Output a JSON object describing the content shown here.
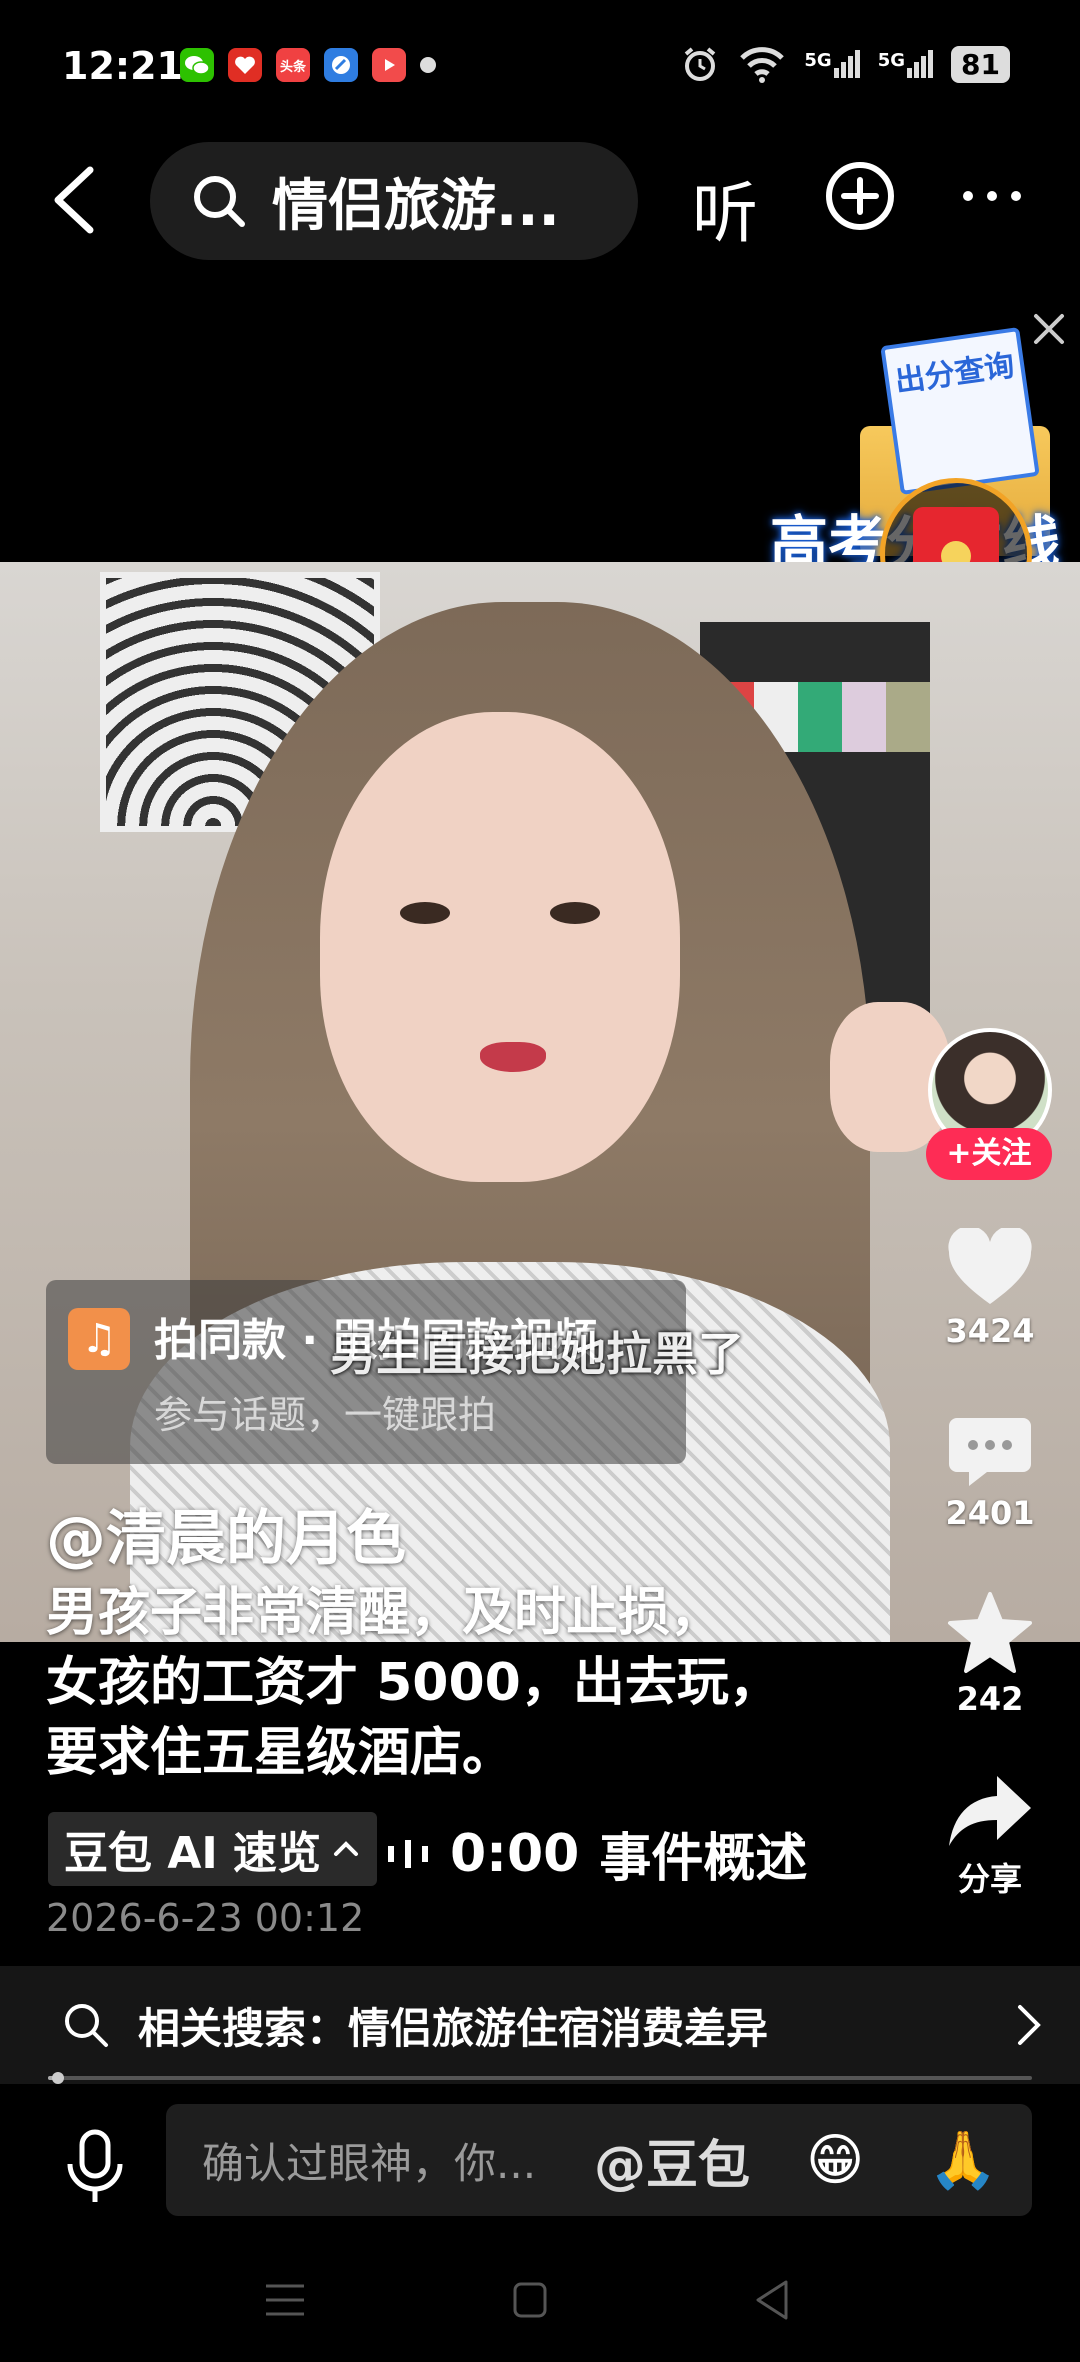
{
  "status_bar": {
    "time": "12:21",
    "apps": [
      "wechat",
      "pinduoduo",
      "toutiao",
      "browser",
      "video"
    ],
    "toutiao_label": "头条",
    "network_1": "5G",
    "network_2": "5G",
    "battery": "81"
  },
  "top_nav": {
    "search_text": "情侣旅游...",
    "listen_label": "听"
  },
  "promo": {
    "card_text": "出分查询",
    "label": "高考分数线"
  },
  "side_actions": {
    "follow_label": "+关注",
    "likes": "3424",
    "comments": "2401",
    "favorites": "242",
    "share_label": "分享"
  },
  "same_clip": {
    "title": "拍同款 · 跟拍同款视频",
    "subtitle": "参与话题，一键跟拍"
  },
  "video": {
    "caption": "男生直接把她拉黑了"
  },
  "post": {
    "author": "@清晨的月色",
    "description_line1": "男孩子非常清醒，及时止损，",
    "description_line2": "女孩的工资才 5000，出去玩，",
    "description_line3": "要求住五星级酒店。",
    "ai_chip_label": "豆包 AI 速览",
    "ai_time": "0:00",
    "ai_event": "事件概述",
    "date": "2026-6-23 00:12"
  },
  "related_search": {
    "text": "相关搜索：情侣旅游住宿消费差异"
  },
  "playback": {
    "progress": 0.01
  },
  "comment_bar": {
    "placeholder": "确认过眼神，你...",
    "at_label": "@豆包",
    "emoji_1": "😁",
    "emoji_2": "🙏"
  }
}
